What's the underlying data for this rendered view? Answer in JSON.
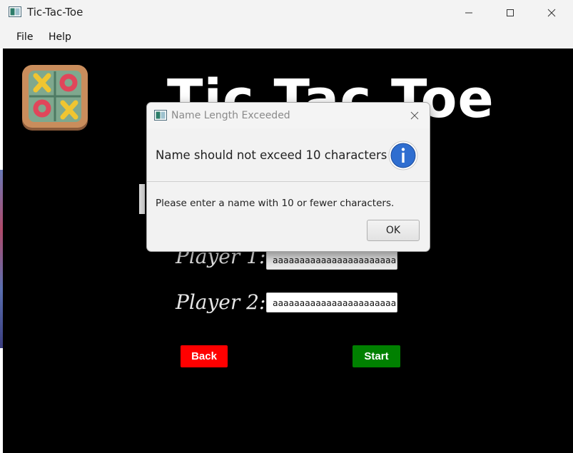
{
  "window": {
    "title": "Tic-Tac-Toe",
    "controls": {
      "minimize_icon": "minimize-icon",
      "maximize_icon": "maximize-icon",
      "close_icon": "close-icon"
    }
  },
  "menu": {
    "items": [
      {
        "label": "File"
      },
      {
        "label": "Help"
      }
    ]
  },
  "game": {
    "title": "Tic Tac Toe",
    "logo_icon": "tic-tac-toe-board-icon",
    "players": [
      {
        "label": "Player 1:",
        "value": "aaaaaaaaaaaaaaaaaaaaaaa"
      },
      {
        "label": "Player 2:",
        "value": "aaaaaaaaaaaaaaaaaaaaaaa"
      }
    ],
    "back_label": "Back",
    "start_label": "Start",
    "colors": {
      "background": "#000000",
      "back_button": "#ff0000",
      "start_button": "#008000"
    }
  },
  "dialog": {
    "title": "Name Length Exceeded",
    "header": "Name should not exceed 10 characters",
    "content": "Please enter a name with 10 or fewer characters.",
    "ok_label": "OK",
    "icon": "info-icon",
    "info_color": "#2f6ed0"
  }
}
